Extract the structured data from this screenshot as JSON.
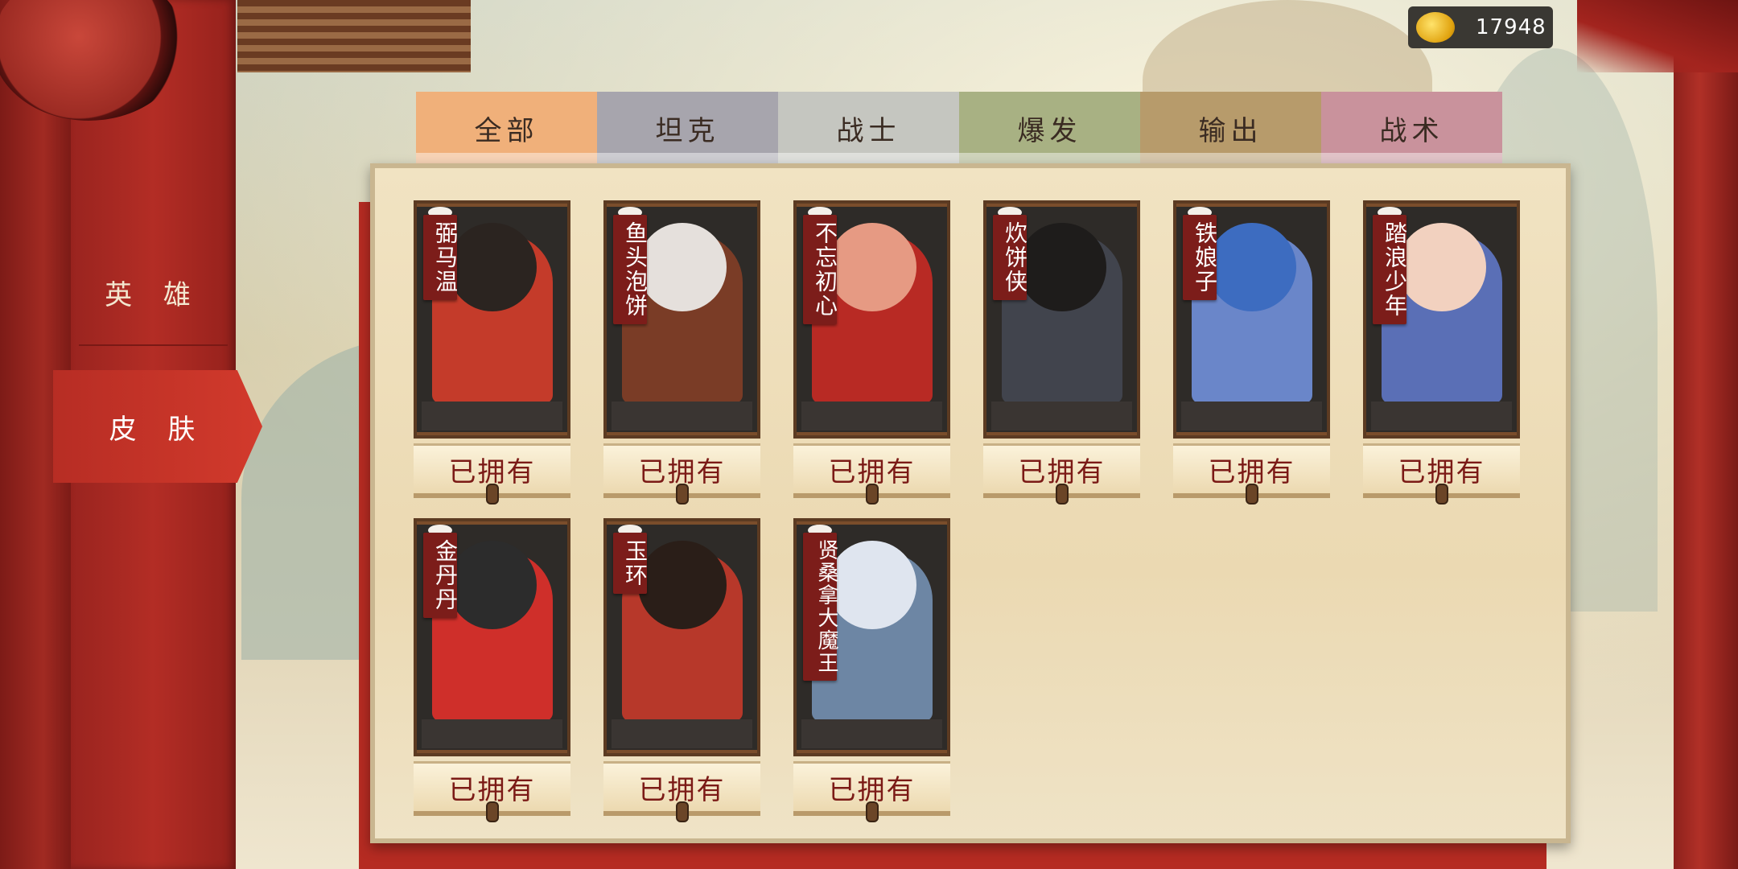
{
  "currency": {
    "icon": "gold-ingot-icon",
    "amount": "17948"
  },
  "sidebar": {
    "logo_icon": "theater-logo-icon",
    "items": [
      {
        "label": "英 雄",
        "active": false
      },
      {
        "label": "皮 肤",
        "active": true
      }
    ]
  },
  "tabs": [
    {
      "label": "全部",
      "color": "#f0b07a",
      "active": true
    },
    {
      "label": "坦克",
      "color": "#a7a5ad",
      "active": false
    },
    {
      "label": "战士",
      "color": "#c5c6c0",
      "active": false
    },
    {
      "label": "爆发",
      "color": "#a8b183",
      "active": false
    },
    {
      "label": "输出",
      "color": "#b79b6b",
      "active": false
    },
    {
      "label": "战术",
      "color": "#c9929c",
      "active": false
    }
  ],
  "skins": [
    {
      "name": "弼马温",
      "status": "已拥有",
      "head": "#2b2420",
      "body": "#c43b2a"
    },
    {
      "name": "鱼头泡饼",
      "status": "已拥有",
      "head": "#e5e0dc",
      "body": "#7a3c26"
    },
    {
      "name": "不忘初心",
      "status": "已拥有",
      "head": "#e69a83",
      "body": "#b82a24"
    },
    {
      "name": "炊饼侠",
      "status": "已拥有",
      "head": "#1e1c1b",
      "body": "#41444d"
    },
    {
      "name": "铁娘子",
      "status": "已拥有",
      "head": "#3d6cc0",
      "body": "#6a86c9"
    },
    {
      "name": "踏浪少年",
      "status": "已拥有",
      "head": "#f2d1bf",
      "body": "#5a6fb6"
    },
    {
      "name": "金丹丹",
      "status": "已拥有",
      "head": "#2c2c2c",
      "body": "#cf2f2a"
    },
    {
      "name": "玉环",
      "status": "已拥有",
      "head": "#2a1e18",
      "body": "#b7382a"
    },
    {
      "name": "贤桑拿大魔王",
      "status": "已拥有",
      "head": "#dfe5ef",
      "body": "#6d86a4"
    }
  ]
}
